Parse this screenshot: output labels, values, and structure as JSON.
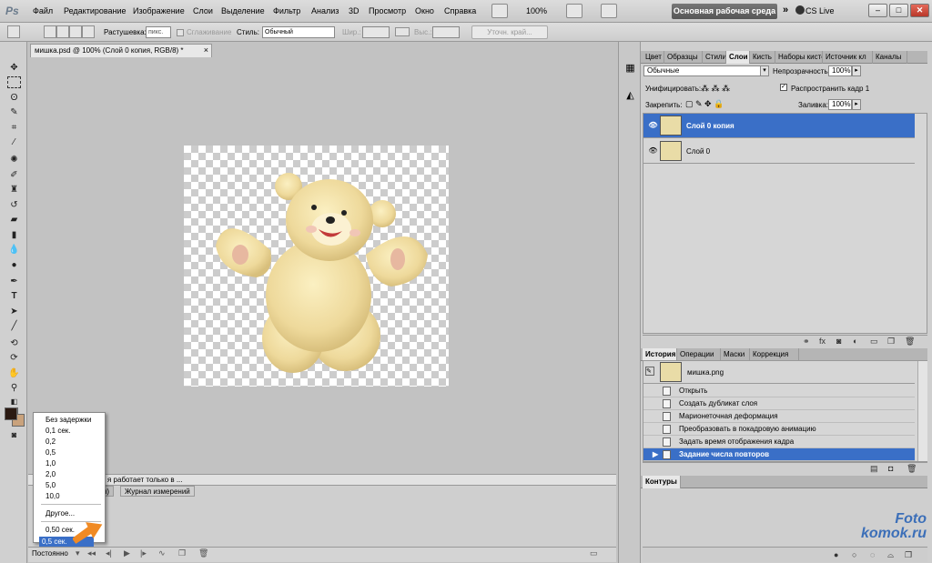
{
  "menubar": {
    "logo": "Ps",
    "items": [
      "Файл",
      "Редактирование",
      "Изображение",
      "Слои",
      "Выделение",
      "Фильтр",
      "Анализ",
      "3D",
      "Просмотр",
      "Окно",
      "Справка"
    ],
    "zoom": "100%",
    "workspace": "Основная рабочая среда",
    "more": "»",
    "cs_live": "CS Live",
    "win_min": "–",
    "win_max": "□",
    "win_close": "✕"
  },
  "options": {
    "feather_label": "Растушевка:",
    "feather_value": "пикс.",
    "antialias_label": "Сглаживание",
    "style_label": "Стиль:",
    "style_value": "Обычный",
    "width_label": "Шир.:",
    "height_label": "Выс.:",
    "refine_label": "Уточн. край..."
  },
  "document": {
    "tab_title": "мишка.psd @ 100% (Слой 0 копия, RGB/8) *",
    "tab_close": "×",
    "status": "я работает только в ..."
  },
  "animation": {
    "tab_left": "я)",
    "tab_right": "Журнал измерений",
    "loop_label": "Постоянно"
  },
  "delay_menu": {
    "items": [
      "Без задержки",
      "0,1 сек.",
      "0,2",
      "0,5",
      "1,0",
      "2,0",
      "5,0",
      "10,0"
    ],
    "other": "Другое...",
    "current": "0,50 сек.",
    "selected": "0,5 сек."
  },
  "layers_panel": {
    "tabs": [
      "Цвет",
      "Образцы",
      "Стили",
      "Слои",
      "Кисть",
      "Наборы кисте",
      "Источник кл",
      "Каналы"
    ],
    "active_tab": "Слои",
    "blend_mode": "Обычные",
    "opacity_label": "Непрозрачность:",
    "opacity_value": "100%",
    "unify_label": "Унифицировать:",
    "propagate_label": "Распространить кадр 1",
    "lock_label": "Закрепить:",
    "fill_label": "Заливка:",
    "fill_value": "100%",
    "layers": [
      {
        "name": "Слой 0 копия",
        "selected": true
      },
      {
        "name": "Слой 0",
        "selected": false
      }
    ]
  },
  "history_panel": {
    "tabs": [
      "История",
      "Операции",
      "Маски",
      "Коррекция"
    ],
    "active_tab": "История",
    "snapshot": "мишка.png",
    "items": [
      "Открыть",
      "Создать дубликат слоя",
      "Марионеточная деформация",
      "Преобразовать в покадровую анимацию",
      "Задать время отображения кадра",
      "Задание числа повторов"
    ],
    "selected_index": 5
  },
  "paths_panel": {
    "title": "Контуры"
  },
  "watermark": {
    "line1": "Foto",
    "line2": "komok.ru"
  },
  "colors": {
    "selection": "#3a6fc7",
    "arrow": "#f08a24"
  }
}
